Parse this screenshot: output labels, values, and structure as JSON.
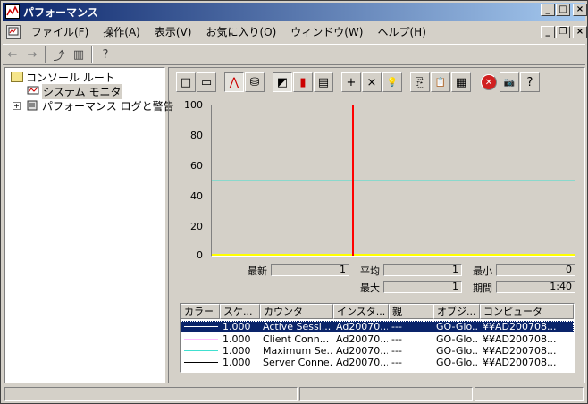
{
  "window": {
    "title": "パフォーマンス"
  },
  "caption_buttons": {
    "minimize": "_",
    "maximize": "□",
    "close": "×"
  },
  "menu": {
    "items": [
      {
        "label": "ファイル(F)"
      },
      {
        "label": "操作(A)"
      },
      {
        "label": "表示(V)"
      },
      {
        "label": "お気に入り(O)"
      },
      {
        "label": "ウィンドウ(W)"
      },
      {
        "label": "ヘルプ(H)"
      }
    ],
    "mdi_buttons": {
      "minimize": "_",
      "restore": "❐",
      "close": "×"
    }
  },
  "toolbar": {
    "icons": [
      "back-arrow-icon",
      "forward-arrow-icon",
      "up-folder-icon",
      "show-hide-tree-icon",
      "help-icon"
    ],
    "back_glyph": "←",
    "forward_glyph": "→",
    "up_glyph": "⤴",
    "tree_glyph": "▥",
    "help_glyph": "?"
  },
  "tree": {
    "root": "コンソール ルート",
    "system_monitor": "システム モニタ",
    "logs": "パフォーマンス ログと警告",
    "expander": "+"
  },
  "sysmon_toolbar": {
    "glyphs": [
      "□",
      "▭",
      "⋀",
      "⛁",
      "◩",
      "▮",
      "▤",
      "+",
      "×",
      "💡",
      "⎘",
      "📋",
      "▦",
      "✕",
      "📷",
      "?"
    ]
  },
  "chart_data": {
    "type": "line",
    "ylim": [
      0,
      100
    ],
    "yticks": [
      "100",
      "80",
      "60",
      "40",
      "20",
      "0"
    ],
    "series": [
      {
        "name": "Active Sessi...",
        "color": "#000000",
        "values": []
      },
      {
        "name": "Client Conne...",
        "color": "#ffc0ff",
        "values": []
      },
      {
        "name": "Maximum Se...",
        "color": "#40e0d0",
        "value": 50
      },
      {
        "name": "Server Conne...",
        "color": "#ffff00",
        "value": 0
      }
    ],
    "time_bar_color": "#ff0000",
    "time_bar_position": 0.39
  },
  "stats": {
    "last_label": "最新",
    "last_value": "1",
    "avg_label": "平均",
    "avg_value": "1",
    "min_label": "最小",
    "min_value": "0",
    "max_label": "最大",
    "max_value": "1",
    "duration_label": "期間",
    "duration_value": "1:40"
  },
  "legend": {
    "headers": [
      "カラー",
      "スケ...",
      "カウンタ",
      "インスタ...",
      "親",
      "オブジ...",
      "コンピュータ"
    ],
    "rows": [
      {
        "color": "#ffffff",
        "scale": "1.000",
        "counter": "Active Sessi...",
        "instance": "Ad20070...",
        "parent": "---",
        "object": "GO-Glo...",
        "computer": "¥¥AD200708..."
      },
      {
        "color": "#ffc0ff",
        "scale": "1.000",
        "counter": "Client Conn...",
        "instance": "Ad20070...",
        "parent": "---",
        "object": "GO-Glo...",
        "computer": "¥¥AD200708..."
      },
      {
        "color": "#40e0d0",
        "scale": "1.000",
        "counter": "Maximum Se...",
        "instance": "Ad20070...",
        "parent": "---",
        "object": "GO-Glo...",
        "computer": "¥¥AD200708..."
      },
      {
        "color": "#000000",
        "scale": "1.000",
        "counter": "Server Conne...",
        "instance": "Ad20070...",
        "parent": "---",
        "object": "GO-Glo...",
        "computer": "¥¥AD200708..."
      }
    ]
  }
}
